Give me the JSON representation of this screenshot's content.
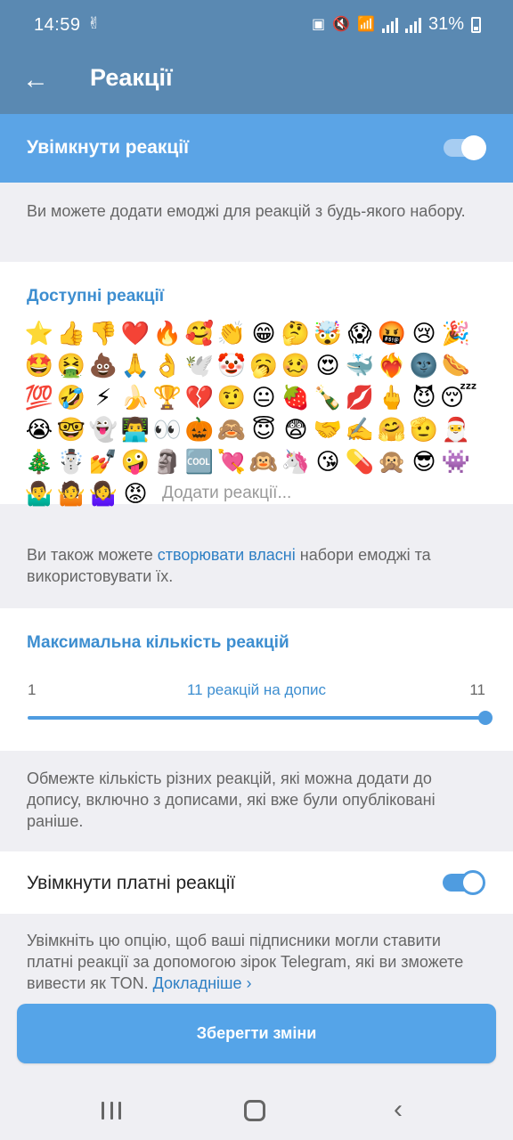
{
  "status_bar": {
    "time": "14:59",
    "battery": "31%",
    "notification_icon": "hand-icon",
    "icons": [
      "sim-icon",
      "mute-icon",
      "wifi-icon",
      "signal-icon",
      "signal-icon",
      "battery-icon"
    ]
  },
  "header": {
    "title": "Реакції",
    "back_icon": "arrow-left-icon",
    "colors": {
      "appbar": "#5a89b2",
      "enable_row": "#5ba4e6",
      "accent": "#3d8ed0"
    }
  },
  "enable_reactions": {
    "label": "Увімкнути реакції",
    "enabled": true
  },
  "hints": {
    "add_from_any_set": "Ви можете додати емоджі для реакцій з будь-якого набору.",
    "create_prefix": "Ви також можете ",
    "create_link": "створювати власні",
    "create_suffix": " набори емоджі та використовувати їх.",
    "limit": "Обмежте кількість різних реакцій, які можна додати до допису, включно з дописами, які вже були опубліковані раніше.",
    "paid_text": "Увімкніть цю опцію, щоб ваші підписники могли ставити платні реакції за допомогою зірок Telegram, які ви зможете вивести як TON. ",
    "paid_link": "Докладніше ›"
  },
  "available_reactions": {
    "title": "Доступні реакції",
    "emojis": [
      "⭐",
      "👍",
      "👎",
      "❤️",
      "🔥",
      "🥰",
      "👏",
      "😁",
      "🤔",
      "🤯",
      "😱",
      "🤬",
      "😢",
      "🎉",
      "🤩",
      "🤮",
      "💩",
      "🙏",
      "👌",
      "🕊️",
      "🤡",
      "🥱",
      "🥴",
      "😍",
      "🐳",
      "❤️‍🔥",
      "🌚",
      "🌭",
      "💯",
      "🤣",
      "⚡",
      "🍌",
      "🏆",
      "💔",
      "🤨",
      "😐",
      "🍓",
      "🍾",
      "💋",
      "🖕",
      "😈",
      "😴",
      "😭",
      "🤓",
      "👻",
      "👨‍💻",
      "👀",
      "🎃",
      "🙈",
      "😇",
      "😨",
      "🤝",
      "✍️",
      "🤗",
      "🫡",
      "🎅",
      "🎄",
      "☃️",
      "💅",
      "🤪",
      "🗿",
      "🆒",
      "💘",
      "🙉",
      "🦄",
      "😘",
      "💊",
      "🙊",
      "😎",
      "👾",
      "🤷‍♂️",
      "🤷",
      "🤷‍♀️",
      "😡"
    ],
    "add_label": "Додати реакції..."
  },
  "max_reactions": {
    "title": "Максимальна кількість реакцій",
    "min_label": "1",
    "value_label": "11 реакцій на допис",
    "max_label": "11",
    "value": 11,
    "min": 1,
    "max": 11
  },
  "paid_reactions": {
    "label": "Увімкнути платні реакції",
    "enabled": true
  },
  "save_button": {
    "label": "Зберегти зміни"
  }
}
